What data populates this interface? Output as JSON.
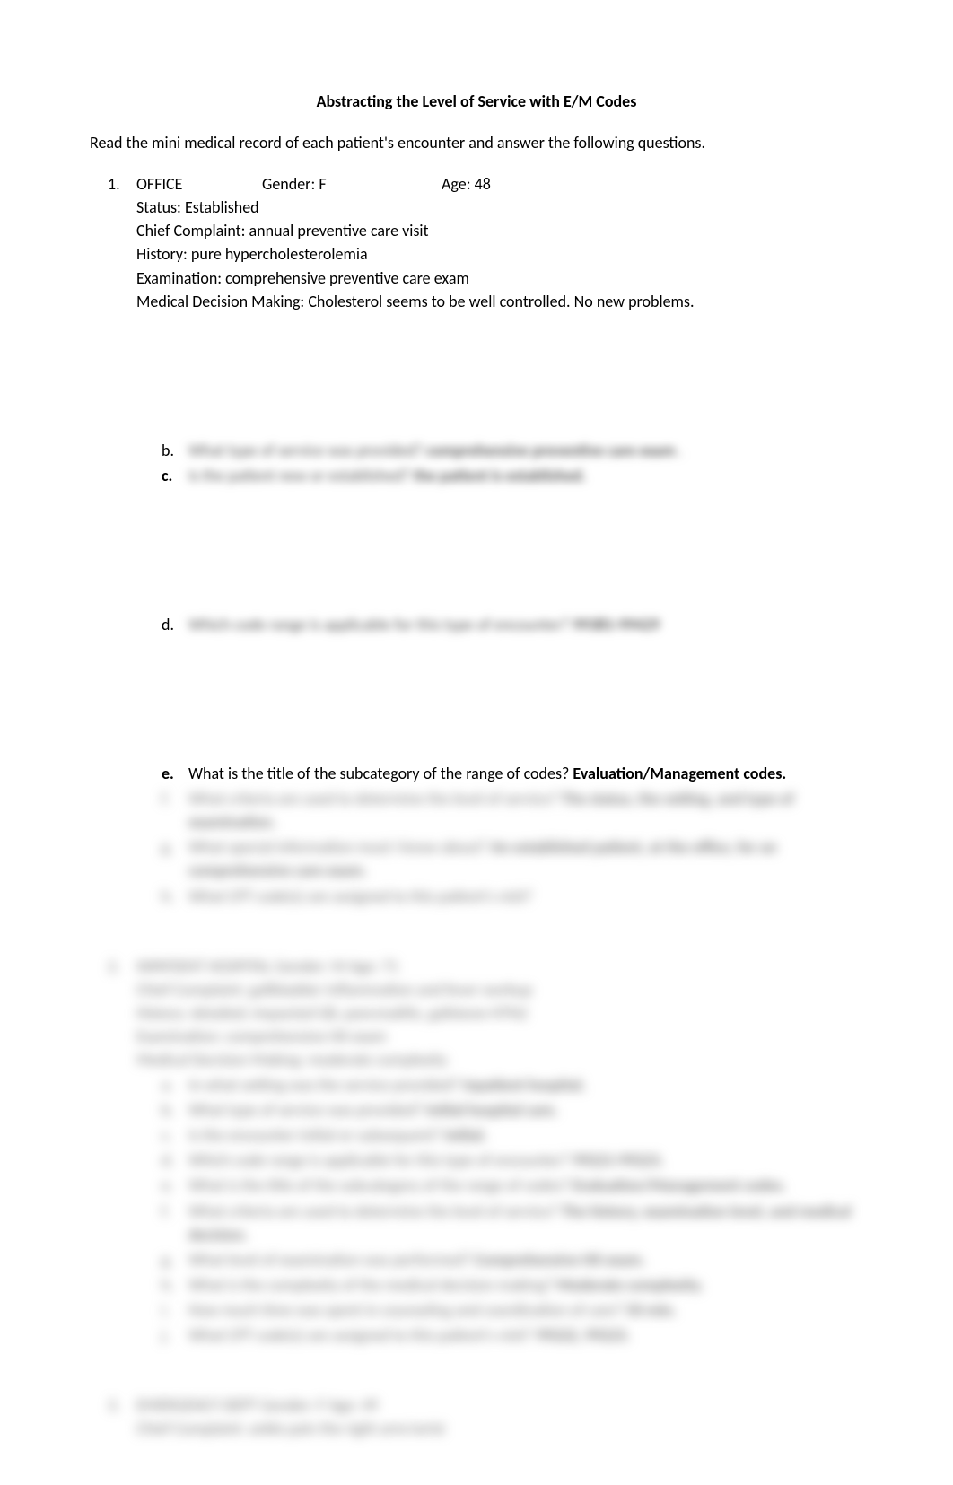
{
  "title": "Abstracting the Level of Service with E/M Codes",
  "instructions": "Read the mini medical record of each patient's encounter and answer the following questions.",
  "q1": {
    "num": "1.",
    "office": "OFFICE",
    "gender": "Gender: F",
    "age": "Age: 48",
    "status": "Status: Established",
    "complaint": "Chief Complaint: annual preventive care visit",
    "history": "History: pure hypercholesterolemia",
    "exam": "Examination: comprehensive preventive care exam",
    "mdm": "Medical Decision Making: Cholesterol seems to be well controlled. No new problems.",
    "b": {
      "letter": "b.",
      "q": "What type of service was provided?  ",
      "a": "comprehensive preventive care exam",
      "suffix": " ."
    },
    "c": {
      "letter": "c.",
      "q": "Is the patient new or established?  ",
      "a": "the patient is established.               "
    },
    "d": {
      "letter": "d.",
      "q": "Which code range is applicable for this type of encounter?  ",
      "a": "99381-99429"
    },
    "e": {
      "letter": "e.",
      "q": "What is the title of the subcategory of the range of codes? ",
      "a": "Evaluation/Management codes."
    },
    "f": {
      "letter": "f.",
      "q": "What criteria are used to determine the level of service?  ",
      "a": "The status, the setting, and type of examination."
    },
    "g": {
      "letter": "g.",
      "q": "What special information must I know about?  ",
      "a": "An established patient, at the office, for an comprehensive care exam."
    },
    "h": {
      "letter": "h.",
      "q": "What CPT code(s) are assigned to this patient's visit?"
    }
  },
  "q2": {
    "num": "2.",
    "header": "INPATIENT HOSPITAL        Gender: M                        Age: 71",
    "complaint": "Chief Complaint: gallbladder inflammation and fever workup",
    "history": "History: detailed; impacted GB, pancreatitis, gallstone HTN2",
    "exam": "Examination: comprehensive HX exam",
    "mdm": "Medical Decision Making: moderate complexity",
    "a": {
      "letter": "a.",
      "q": "In what setting was the service provided?  ",
      "a": "Inpatient hospital."
    },
    "b": {
      "letter": "b.",
      "q": "What type of service was provided?  ",
      "a": "Initial hospital care."
    },
    "c": {
      "letter": "c.",
      "q": "Is the encounter initial or subsequent?  ",
      "a": "Initial."
    },
    "d": {
      "letter": "d.",
      "q": "Which code range is applicable for this type of encounter?  ",
      "a": "99221-99223."
    },
    "e": {
      "letter": "e.",
      "q": "What is the title of the subcategory of the range of codes?  ",
      "a": "Evaluation/Management codes."
    },
    "f": {
      "letter": "f.",
      "q": "What criteria are used to determine the level of service?  ",
      "a": "The history, examination level, and medical decision."
    },
    "g": {
      "letter": "g.",
      "q": "What level of examination was performed?  ",
      "a": "Comprehensive HX exam."
    },
    "h": {
      "letter": "h.",
      "q": "What is the complexity of the medical decision making?  ",
      "a": "Moderate complexity."
    },
    "i": {
      "letter": "i.",
      "q": "How much time was spent in counseling and coordination of care?  ",
      "a": "50 min."
    },
    "j": {
      "letter": "j.",
      "q": "What CPT code(s) are assigned to this patient's visit?  ",
      "a": "99222, 99223."
    }
  },
  "q3": {
    "num": "3.",
    "header": "EMERGENCY DEPT        Gender: F              Age: 49",
    "complaint": "Chief Complaint: ankle pain the right arm/wrist"
  }
}
